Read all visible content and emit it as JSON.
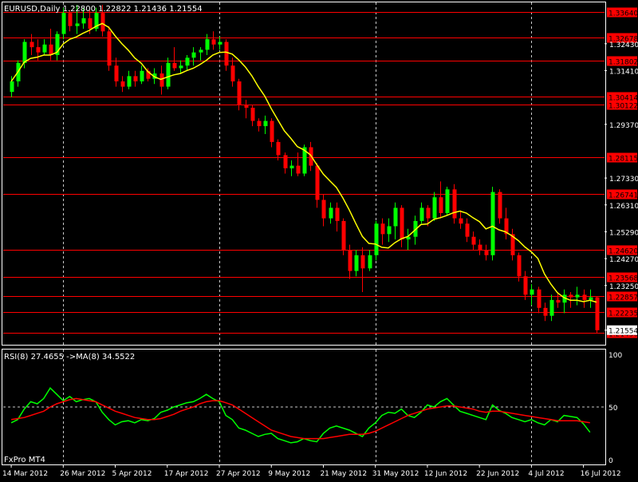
{
  "colors": {
    "background": "#000000",
    "frame": "#ffffff",
    "text": "#ffffff",
    "bull_candle": "#00ff00",
    "bear_candle": "#ff0000",
    "ma_line": "#ffff00",
    "hline": "#ff0000",
    "hline_label_bg": "#ff0000",
    "rsi_line": "#00ff00",
    "rsi_ma_line": "#ff0000",
    "grid": "#c8c8c8"
  },
  "header": {
    "main": "EURUSD,Daily  1.22800 1.22822 1.21436 1.21554",
    "indicator": "RSI(8) 27.4655  ->MA(8) 34.5522",
    "watermark": "FxPro MT4"
  },
  "chart_data": [
    {
      "type": "candlestick",
      "ylim": [
        1.21,
        1.34
      ],
      "price_ticks": [
        "1.32430",
        "1.31410",
        "1.29370",
        "1.27330",
        "1.26310",
        "1.25290",
        "1.24270",
        "1.23250",
        "1.21554"
      ],
      "current_price": "1.21554",
      "horizontal_lines": [
        {
          "value": 1.3364,
          "label": "1.33640"
        },
        {
          "value": 1.32678,
          "label": "1.32678"
        },
        {
          "value": 1.31802,
          "label": "1.31802"
        },
        {
          "value": 1.30414,
          "label": "1.30414"
        },
        {
          "value": 1.30122,
          "label": "1.30122"
        },
        {
          "value": 1.28115,
          "label": "1.28115"
        },
        {
          "value": 1.26741,
          "label": "1.26741"
        },
        {
          "value": 1.2462,
          "label": "1.24620"
        },
        {
          "value": 1.23568,
          "label": "1.23568"
        },
        {
          "value": 1.22857,
          "label": "1.22857"
        },
        {
          "value": 1.22235,
          "label": "1.22235"
        },
        {
          "value": 1.2145,
          "label": "1.21450"
        }
      ],
      "date_labels": [
        "14 Mar 2012",
        "26 Mar 2012",
        "5 Apr 2012",
        "17 Apr 2012",
        "27 Apr 2012",
        "9 May 2012",
        "21 May 2012",
        "31 May 2012",
        "12 Jun 2012",
        "22 Jun 2012",
        "4 Jul 2012",
        "16 Jul 2012"
      ],
      "date_label_bars": [
        0,
        8,
        16,
        24,
        32,
        40,
        48,
        56,
        64,
        72,
        80,
        88
      ],
      "grid_bars": [
        8,
        32,
        56,
        80
      ],
      "candles": [
        [
          1.306,
          1.312,
          1.304,
          1.31
        ],
        [
          1.31,
          1.318,
          1.308,
          1.317
        ],
        [
          1.317,
          1.326,
          1.315,
          1.325
        ],
        [
          1.325,
          1.328,
          1.32,
          1.323
        ],
        [
          1.323,
          1.326,
          1.318,
          1.321
        ],
        [
          1.321,
          1.326,
          1.32,
          1.324
        ],
        [
          1.324,
          1.33,
          1.318,
          1.32
        ],
        [
          1.32,
          1.329,
          1.318,
          1.328
        ],
        [
          1.328,
          1.338,
          1.326,
          1.336
        ],
        [
          1.336,
          1.337,
          1.329,
          1.331
        ],
        [
          1.331,
          1.339,
          1.328,
          1.332
        ],
        [
          1.332,
          1.338,
          1.33,
          1.334
        ],
        [
          1.334,
          1.337,
          1.328,
          1.33
        ],
        [
          1.33,
          1.338,
          1.329,
          1.336
        ],
        [
          1.336,
          1.339,
          1.327,
          1.329
        ],
        [
          1.329,
          1.331,
          1.314,
          1.316
        ],
        [
          1.316,
          1.319,
          1.308,
          1.31
        ],
        [
          1.31,
          1.312,
          1.306,
          1.308
        ],
        [
          1.308,
          1.314,
          1.307,
          1.312
        ],
        [
          1.312,
          1.314,
          1.308,
          1.31
        ],
        [
          1.31,
          1.316,
          1.309,
          1.314
        ],
        [
          1.314,
          1.315,
          1.31,
          1.311
        ],
        [
          1.311,
          1.315,
          1.309,
          1.313
        ],
        [
          1.313,
          1.316,
          1.305,
          1.308
        ],
        [
          1.308,
          1.319,
          1.307,
          1.317
        ],
        [
          1.317,
          1.323,
          1.314,
          1.315
        ],
        [
          1.315,
          1.318,
          1.313,
          1.316
        ],
        [
          1.316,
          1.32,
          1.314,
          1.319
        ],
        [
          1.319,
          1.323,
          1.316,
          1.321
        ],
        [
          1.321,
          1.323,
          1.318,
          1.322
        ],
        [
          1.322,
          1.328,
          1.32,
          1.326
        ],
        [
          1.326,
          1.329,
          1.322,
          1.324
        ],
        [
          1.324,
          1.327,
          1.322,
          1.325
        ],
        [
          1.325,
          1.326,
          1.314,
          1.316
        ],
        [
          1.316,
          1.319,
          1.308,
          1.31
        ],
        [
          1.31,
          1.311,
          1.299,
          1.301
        ],
        [
          1.301,
          1.303,
          1.296,
          1.3
        ],
        [
          1.3,
          1.301,
          1.293,
          1.295
        ],
        [
          1.295,
          1.296,
          1.291,
          1.293
        ],
        [
          1.293,
          1.297,
          1.29,
          1.295
        ],
        [
          1.295,
          1.296,
          1.285,
          1.287
        ],
        [
          1.287,
          1.288,
          1.28,
          1.282
        ],
        [
          1.282,
          1.283,
          1.275,
          1.277
        ],
        [
          1.277,
          1.28,
          1.274,
          1.278
        ],
        [
          1.278,
          1.283,
          1.274,
          1.275
        ],
        [
          1.275,
          1.286,
          1.274,
          1.285
        ],
        [
          1.285,
          1.287,
          1.276,
          1.278
        ],
        [
          1.278,
          1.279,
          1.262,
          1.265
        ],
        [
          1.265,
          1.267,
          1.255,
          1.258
        ],
        [
          1.258,
          1.264,
          1.256,
          1.262
        ],
        [
          1.262,
          1.264,
          1.253,
          1.257
        ],
        [
          1.257,
          1.258,
          1.244,
          1.246
        ],
        [
          1.246,
          1.248,
          1.235,
          1.238
        ],
        [
          1.238,
          1.246,
          1.236,
          1.244
        ],
        [
          1.244,
          1.247,
          1.23,
          1.239
        ],
        [
          1.239,
          1.246,
          1.238,
          1.244
        ],
        [
          1.244,
          1.257,
          1.242,
          1.256
        ],
        [
          1.256,
          1.258,
          1.248,
          1.252
        ],
        [
          1.252,
          1.258,
          1.249,
          1.255
        ],
        [
          1.255,
          1.264,
          1.25,
          1.262
        ],
        [
          1.262,
          1.263,
          1.247,
          1.25
        ],
        [
          1.25,
          1.254,
          1.246,
          1.251
        ],
        [
          1.251,
          1.259,
          1.248,
          1.257
        ],
        [
          1.257,
          1.264,
          1.256,
          1.262
        ],
        [
          1.262,
          1.263,
          1.255,
          1.258
        ],
        [
          1.258,
          1.268,
          1.257,
          1.266
        ],
        [
          1.266,
          1.272,
          1.258,
          1.26
        ],
        [
          1.26,
          1.27,
          1.259,
          1.269
        ],
        [
          1.269,
          1.271,
          1.256,
          1.258
        ],
        [
          1.258,
          1.261,
          1.254,
          1.256
        ],
        [
          1.256,
          1.258,
          1.249,
          1.251
        ],
        [
          1.251,
          1.253,
          1.246,
          1.248
        ],
        [
          1.248,
          1.25,
          1.244,
          1.246
        ],
        [
          1.246,
          1.248,
          1.242,
          1.244
        ],
        [
          1.244,
          1.27,
          1.242,
          1.268
        ],
        [
          1.268,
          1.269,
          1.256,
          1.258
        ],
        [
          1.258,
          1.262,
          1.25,
          1.252
        ],
        [
          1.252,
          1.254,
          1.242,
          1.244
        ],
        [
          1.244,
          1.245,
          1.234,
          1.236
        ],
        [
          1.236,
          1.238,
          1.227,
          1.229
        ],
        [
          1.229,
          1.233,
          1.225,
          1.231
        ],
        [
          1.231,
          1.232,
          1.222,
          1.224
        ],
        [
          1.224,
          1.226,
          1.219,
          1.221
        ],
        [
          1.221,
          1.229,
          1.219,
          1.227
        ],
        [
          1.227,
          1.23,
          1.224,
          1.226
        ],
        [
          1.226,
          1.231,
          1.222,
          1.229
        ],
        [
          1.229,
          1.23,
          1.224,
          1.228
        ],
        [
          1.228,
          1.232,
          1.225,
          1.229
        ],
        [
          1.229,
          1.231,
          1.224,
          1.227
        ],
        [
          1.227,
          1.231,
          1.224,
          1.228
        ],
        [
          1.228,
          1.2282,
          1.2144,
          1.2155
        ]
      ]
    },
    {
      "type": "line",
      "name": "RSI(8)",
      "ylim": [
        0,
        100
      ],
      "tick_labels": [
        "100",
        "50",
        "0"
      ],
      "level_lines": [
        50
      ],
      "series": [
        {
          "name": "RSI(8)",
          "values": [
            35,
            38,
            48,
            55,
            53,
            58,
            68,
            62,
            56,
            60,
            55,
            57,
            58,
            55,
            45,
            38,
            33,
            36,
            37,
            35,
            38,
            37,
            39,
            45,
            47,
            50,
            52,
            54,
            55,
            58,
            62,
            58,
            55,
            42,
            38,
            30,
            28,
            25,
            22,
            24,
            25,
            20,
            18,
            16,
            17,
            20,
            18,
            17,
            25,
            30,
            32,
            30,
            28,
            25,
            22,
            30,
            35,
            42,
            45,
            44,
            48,
            42,
            40,
            45,
            52,
            50,
            55,
            58,
            52,
            46,
            44,
            42,
            40,
            38,
            52,
            47,
            44,
            40,
            38,
            36,
            38,
            35,
            33,
            38,
            36,
            42,
            41,
            40,
            34,
            26
          ]
        },
        {
          "name": "->MA(8)",
          "values": [
            38,
            39,
            40,
            42,
            44,
            46,
            50,
            53,
            55,
            57,
            58,
            57,
            56,
            55,
            52,
            49,
            46,
            44,
            42,
            40,
            39,
            38,
            38,
            39,
            41,
            43,
            46,
            48,
            50,
            53,
            55,
            56,
            56,
            54,
            52,
            48,
            44,
            40,
            36,
            32,
            28,
            26,
            24,
            22,
            21,
            20,
            20,
            20,
            20,
            21,
            22,
            23,
            24,
            24,
            24,
            25,
            27,
            30,
            33,
            36,
            39,
            42,
            44,
            46,
            48,
            49,
            50,
            51,
            51,
            50,
            49,
            48,
            46,
            45,
            46,
            46,
            45,
            44,
            43,
            42,
            41,
            40,
            39,
            38,
            37,
            37,
            37,
            37,
            36,
            35
          ]
        }
      ],
      "date_labels": [
        "14 Mar 2012",
        "26 Mar 2012",
        "5 Apr 2012",
        "17 Apr 2012",
        "27 Apr 2012",
        "9 May 2012",
        "21 May 2012",
        "31 May 2012",
        "12 Jun 2012",
        "22 Jun 2012",
        "4 Jul 2012",
        "16 Jul 2012"
      ]
    }
  ]
}
